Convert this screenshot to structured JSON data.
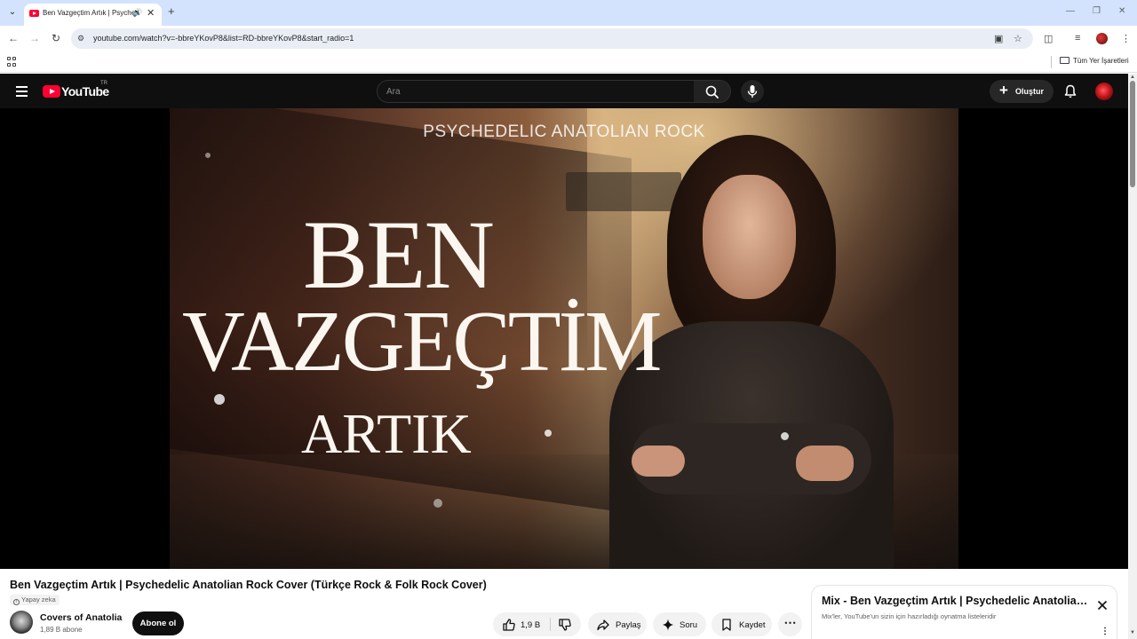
{
  "browser": {
    "tab_title": "Ben Vazgeçtim Artık | Psychedelic Anatolian Rock Cover",
    "url": "youtube.com/watch?v=-bbreYKovP8&list=RD-bbreYKovP8&start_radio=1",
    "bookmark_folder": "Tüm Yer İşaretleri"
  },
  "youtube": {
    "logo_text": "YouTube",
    "country_code": "TR",
    "search_placeholder": "Ara",
    "create_label": "Oluştur"
  },
  "player": {
    "thumbnail_top_text": "PSYCHEDELIC ANATOLIAN ROCK",
    "thumbnail_line1": "BEN",
    "thumbnail_line2": "VAZGEÇTİM",
    "thumbnail_line3": "ARTIK"
  },
  "video": {
    "title": "Ben Vazgeçtim Artık | Psychedelic Anatolian Rock Cover (Türkçe Rock & Folk Rock Cover)",
    "ai_badge": "Yapay zeka",
    "channel_name": "Covers of Anatolia",
    "subscribers": "1,89 B abone",
    "subscribe_label": "Abone ol",
    "like_count": "1,9 B",
    "share_label": "Paylaş",
    "ask_label": "Soru",
    "save_label": "Kaydet"
  },
  "mix": {
    "title": "Mix - Ben Vazgeçtim Artık | Psychedelic Anatolian Rock Cover",
    "subtitle": "Mix'ler, YouTube'un sizin için hazırladığı oynatma listeleridir"
  },
  "colors": {
    "youtube_red": "#ff0033",
    "masthead_bg": "#0f0f0f",
    "chrome_tabstrip": "#d3e3fd"
  }
}
